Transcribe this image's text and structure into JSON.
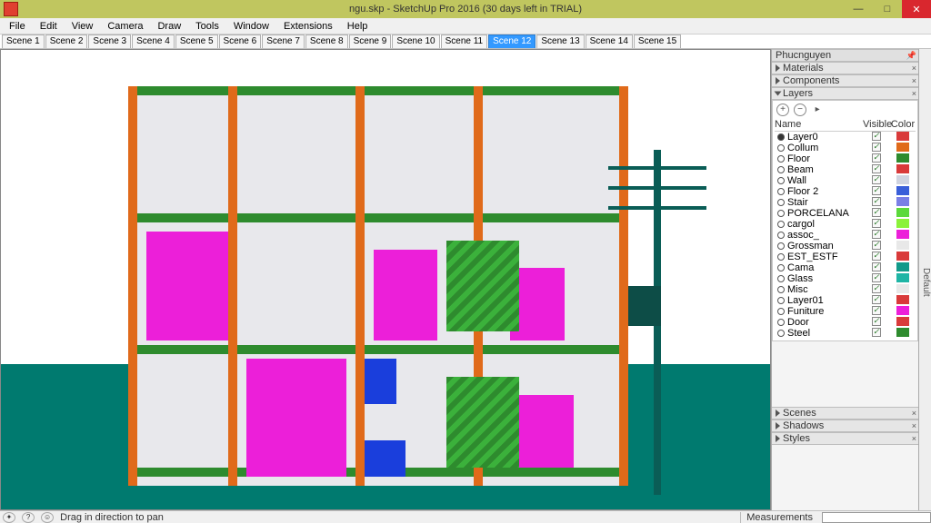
{
  "window": {
    "title": "ngu.skp - SketchUp Pro 2016 (30 days left in TRIAL)"
  },
  "menu": [
    "File",
    "Edit",
    "View",
    "Camera",
    "Draw",
    "Tools",
    "Window",
    "Extensions",
    "Help"
  ],
  "scenes": {
    "tabs": [
      "Scene 1",
      "Scene 2",
      "Scene 3",
      "Scene 4",
      "Scene 5",
      "Scene 6",
      "Scene 7",
      "Scene 8",
      "Scene 9",
      "Scene 10",
      "Scene 11",
      "Scene 12",
      "Scene 13",
      "Scene 14",
      "Scene 15"
    ],
    "active_index": 11
  },
  "tray": {
    "title": "Phucnguyen",
    "side_tab": "Default",
    "sections": {
      "materials": "Materials",
      "components": "Components",
      "layers": "Layers",
      "scenes": "Scenes",
      "shadows": "Shadows",
      "styles": "Styles"
    }
  },
  "layers": {
    "header": {
      "name": "Name",
      "visible": "Visible",
      "color": "Color"
    },
    "rows": [
      {
        "name": "Layer0",
        "active": true,
        "visible": true,
        "color": "#d93a3a"
      },
      {
        "name": "Collum",
        "active": false,
        "visible": true,
        "color": "#e06a1a"
      },
      {
        "name": "Floor",
        "active": false,
        "visible": true,
        "color": "#2e8b2e"
      },
      {
        "name": "Beam",
        "active": false,
        "visible": true,
        "color": "#d93a3a"
      },
      {
        "name": "Wall",
        "active": false,
        "visible": true,
        "color": "#d0d4e0"
      },
      {
        "name": "Floor 2",
        "active": false,
        "visible": true,
        "color": "#3a5fd9"
      },
      {
        "name": "Stair",
        "active": false,
        "visible": true,
        "color": "#7a7fe6"
      },
      {
        "name": "PORCELANA",
        "active": false,
        "visible": true,
        "color": "#5bd93a"
      },
      {
        "name": "cargol",
        "active": false,
        "visible": true,
        "color": "#8bf23a"
      },
      {
        "name": "assoc_",
        "active": false,
        "visible": true,
        "color": "#ec1fd9"
      },
      {
        "name": "Grossman",
        "active": false,
        "visible": true,
        "color": "#e8e8e8"
      },
      {
        "name": "EST_ESTF",
        "active": false,
        "visible": true,
        "color": "#d93a3a"
      },
      {
        "name": "Cama",
        "active": false,
        "visible": true,
        "color": "#139a8a"
      },
      {
        "name": "Glass",
        "active": false,
        "visible": true,
        "color": "#1fb5a5"
      },
      {
        "name": "Misc",
        "active": false,
        "visible": true,
        "color": "#e8e8e8"
      },
      {
        "name": "Layer01",
        "active": false,
        "visible": true,
        "color": "#d93a3a"
      },
      {
        "name": "Funiture",
        "active": false,
        "visible": true,
        "color": "#ec1fd9"
      },
      {
        "name": "Door",
        "active": false,
        "visible": true,
        "color": "#d93a3a"
      },
      {
        "name": "Steel",
        "active": false,
        "visible": true,
        "color": "#2e8b2e"
      }
    ]
  },
  "status": {
    "hint": "Drag in direction to pan",
    "measurements_label": "Measurements",
    "measurements_value": ""
  }
}
